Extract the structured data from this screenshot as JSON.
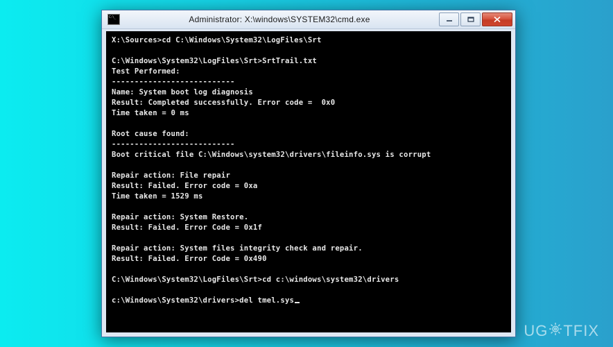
{
  "window": {
    "title": "Administrator: X:\\windows\\SYSTEM32\\cmd.exe"
  },
  "terminal": {
    "lines": [
      "X:\\Sources>cd C:\\Windows\\System32\\LogFiles\\Srt",
      "",
      "C:\\Windows\\System32\\LogFiles\\Srt>SrtTrail.txt",
      "Test Performed:",
      "---------------------------",
      "Name: System boot log diagnosis",
      "Result: Completed successfully. Error code =  0x0",
      "Time taken = 0 ms",
      "",
      "Root cause found:",
      "---------------------------",
      "Boot critical file C:\\Windows\\system32\\drivers\\fileinfo.sys is corrupt",
      "",
      "Repair action: File repair",
      "Result: Failed. Error code = 0xa",
      "Time taken = 1529 ms",
      "",
      "Repair action: System Restore.",
      "Result: Failed. Error Code = 0x1f",
      "",
      "Repair action: System files integrity check and repair.",
      "Result: Failed. Error Code = 0x490",
      "",
      "C:\\Windows\\System32\\LogFiles\\Srt>cd c:\\windows\\system32\\drivers",
      "",
      "c:\\Windows\\System32\\drivers>del tmel.sys"
    ]
  },
  "watermark": {
    "prefix": "UG",
    "suffix": "TFIX"
  }
}
